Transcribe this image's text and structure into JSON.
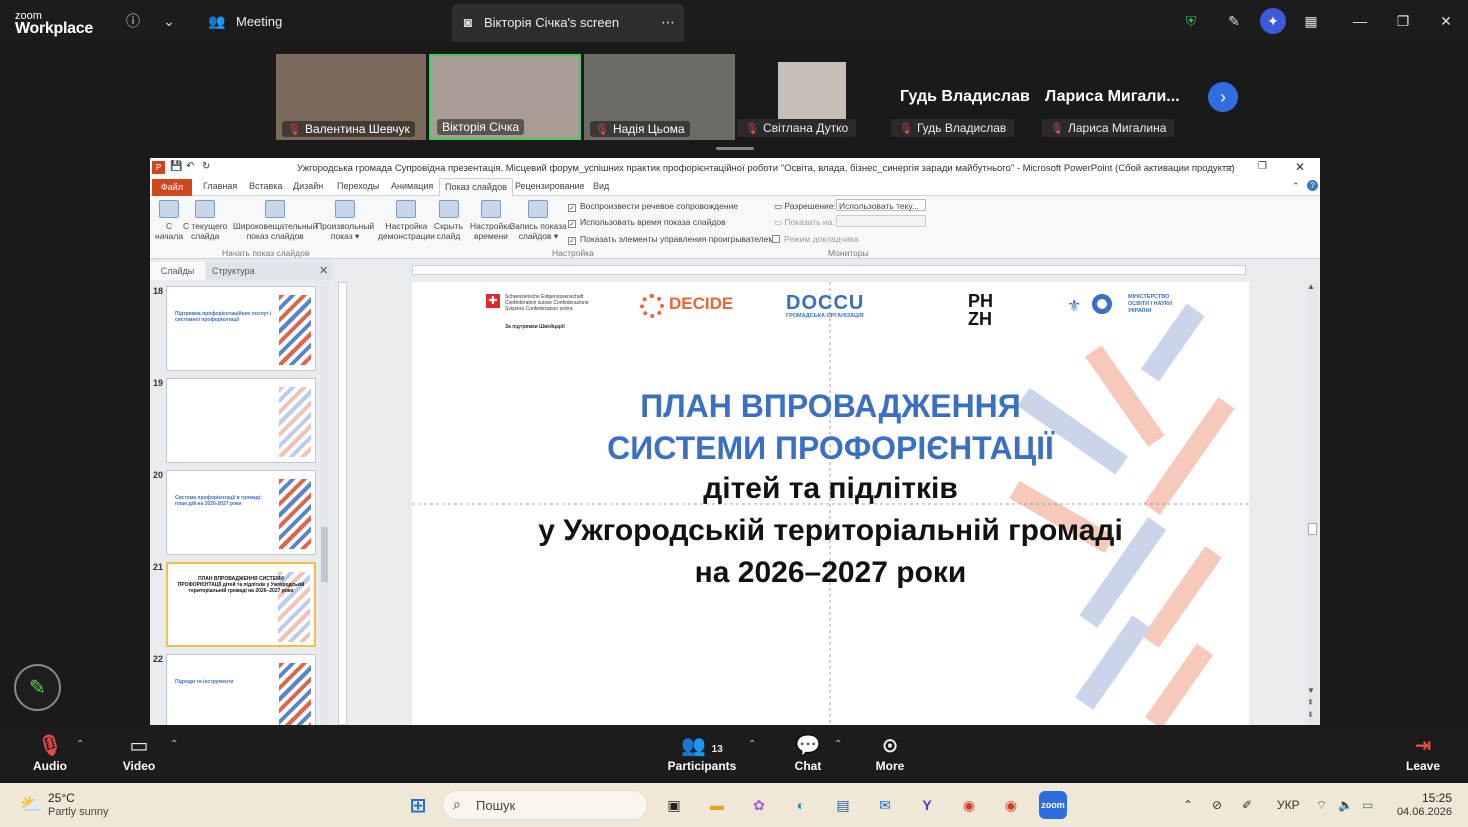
{
  "app": {
    "logo_small": "zoom",
    "logo_big": "Workplace",
    "meeting_label": "Meeting",
    "share_title": "Вікторія Січка's screen"
  },
  "gallery": {
    "tiles": [
      {
        "name": "Валентина Шевчук",
        "bg": "#7a6a5c"
      },
      {
        "name": "Вікторія Січка",
        "bg": "#a89c94",
        "active": true
      },
      {
        "name": "Надія Цьома",
        "bg": "#6e6a66"
      },
      {
        "name": "Світлана Дутко",
        "bg": "#c5bfb8"
      }
    ],
    "name_only": [
      {
        "big": "Гудь Владислав",
        "pill": "Гудь Владислав"
      },
      {
        "big": "Лариса Мигали...",
        "pill": "Лариса Мигалина"
      }
    ]
  },
  "ppt": {
    "window_title": "Ужгородська громада Супровідна презентація. Місцевий форум_успішних практик профорієнтаційної роботи \"Освіта, влада, бізнес_синергія заради майбутнього\" - Microsoft PowerPoint (Сбой активации продукта)",
    "file_tab": "Файл",
    "tabs": [
      "Главная",
      "Вставка",
      "Дизайн",
      "Переходы",
      "Анимация",
      "Показ слайдов",
      "Рецензирование",
      "Вид"
    ],
    "ribbon_buttons": [
      {
        "label1": "С",
        "label2": "начала"
      },
      {
        "label1": "С текущего",
        "label2": "слайда"
      },
      {
        "label1": "Широковещательный",
        "label2": "показ слайдов"
      },
      {
        "label1": "Произвольный",
        "label2": "показ ▾"
      },
      {
        "label1": "Настройка",
        "label2": "демонстрации"
      },
      {
        "label1": "Скрыть",
        "label2": "слайд"
      },
      {
        "label1": "Настройка",
        "label2": "времени"
      },
      {
        "label1": "Запись показа",
        "label2": "слайдов ▾"
      }
    ],
    "checkboxes": [
      "Воспроизвести речевое сопровождение",
      "Использовать время показа слайдов",
      "Показать элементы управления проигрывателем"
    ],
    "group_start": "Начать показ слайдов",
    "group_setup": "Настройка",
    "group_monitors": "Мониторы",
    "monitor_resolution_label": "Разрешение:",
    "monitor_resolution_value": "Использовать теку...",
    "monitor_show_label": "Показать на:",
    "monitor_presenter": "Режим докладчика",
    "panel_tabs": [
      "Слайды",
      "Структура"
    ],
    "thumbs": [
      {
        "num": "18",
        "title": "Підтримка профорієнтаційних послуг і системної профорієнтації"
      },
      {
        "num": "19",
        "title": ""
      },
      {
        "num": "20",
        "title": "Система профорієнтації в громаді: план дій на 2026-2027 роки"
      },
      {
        "num": "21",
        "title": "ПЛАН ВПРОВАДЖЕННЯ СИСТЕМИ ПРОФОРІЄНТАЦІЇ дітей та підлітків у Ужгородській територіальній громаді на 2026–2027 роки",
        "selected": true
      },
      {
        "num": "22",
        "title": "Підходи та інструменти"
      }
    ],
    "slide": {
      "logos": [
        "Schweizerische Eidgenossenschaft Confédération suisse Confederazione Svizzera Confederaziun svizra",
        "За підтримки Швейцарії",
        "DECIDE",
        "DOCCU",
        "ГРОМАДСЬКА ОРГАНІЗАЦІЯ",
        "PH ZH",
        "МІНІСТЕРСТВО ОСВІТИ І НАУКИ УКРАЇНИ"
      ],
      "line1": "ПЛАН ВПРОВАДЖЕННЯ",
      "line2": "СИСТЕМИ ПРОФОРІЄНТАЦІЇ",
      "line3": "дітей та підлітків",
      "line4": "у Ужгородській територіальній громаді",
      "line5": "на 2026–2027 роки",
      "title_color": "#3a6fc4"
    }
  },
  "controls": {
    "audio": "Audio",
    "video": "Video",
    "participants": "Participants",
    "participant_count": "13",
    "chat": "Chat",
    "more": "More",
    "leave": "Leave"
  },
  "taskbar": {
    "weather_temp": "25°C",
    "weather_desc": "Partly sunny",
    "search_placeholder": "Пошук",
    "lang": "УКР",
    "time": "15:25",
    "date": "04.06.2026"
  }
}
